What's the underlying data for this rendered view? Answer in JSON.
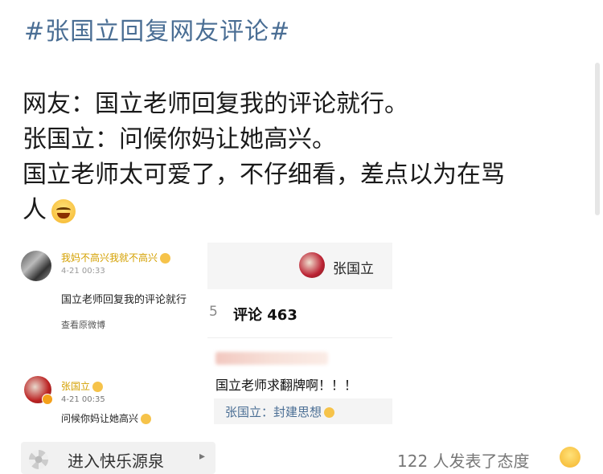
{
  "post": {
    "hashtag": "#张国立回复网友评论#",
    "lines": [
      "网友：国立老师回复我的评论就行。",
      "张国立：问候你妈让她高兴。",
      "国立老师太可爱了，不仔细看，差点以为在骂",
      "人"
    ]
  },
  "left_panel": {
    "comment1": {
      "user": "我妈不高兴我就不高兴",
      "time": "4-21 00:33",
      "text": "国立老师回复我的评论就行",
      "link": "查看原微博"
    },
    "comment2": {
      "user": "张国立",
      "time": "4-21 00:35",
      "text": "问候你妈让她高兴"
    }
  },
  "right_panel": {
    "name": "张国立",
    "tab_prev": "5",
    "tab_active": "评论 463",
    "comment": "国立老师求翻牌啊！！！",
    "reply": "张国立：封建思想"
  },
  "footer": {
    "enter_label": "进入快乐源泉",
    "count_text": "122 人发表了态度"
  }
}
